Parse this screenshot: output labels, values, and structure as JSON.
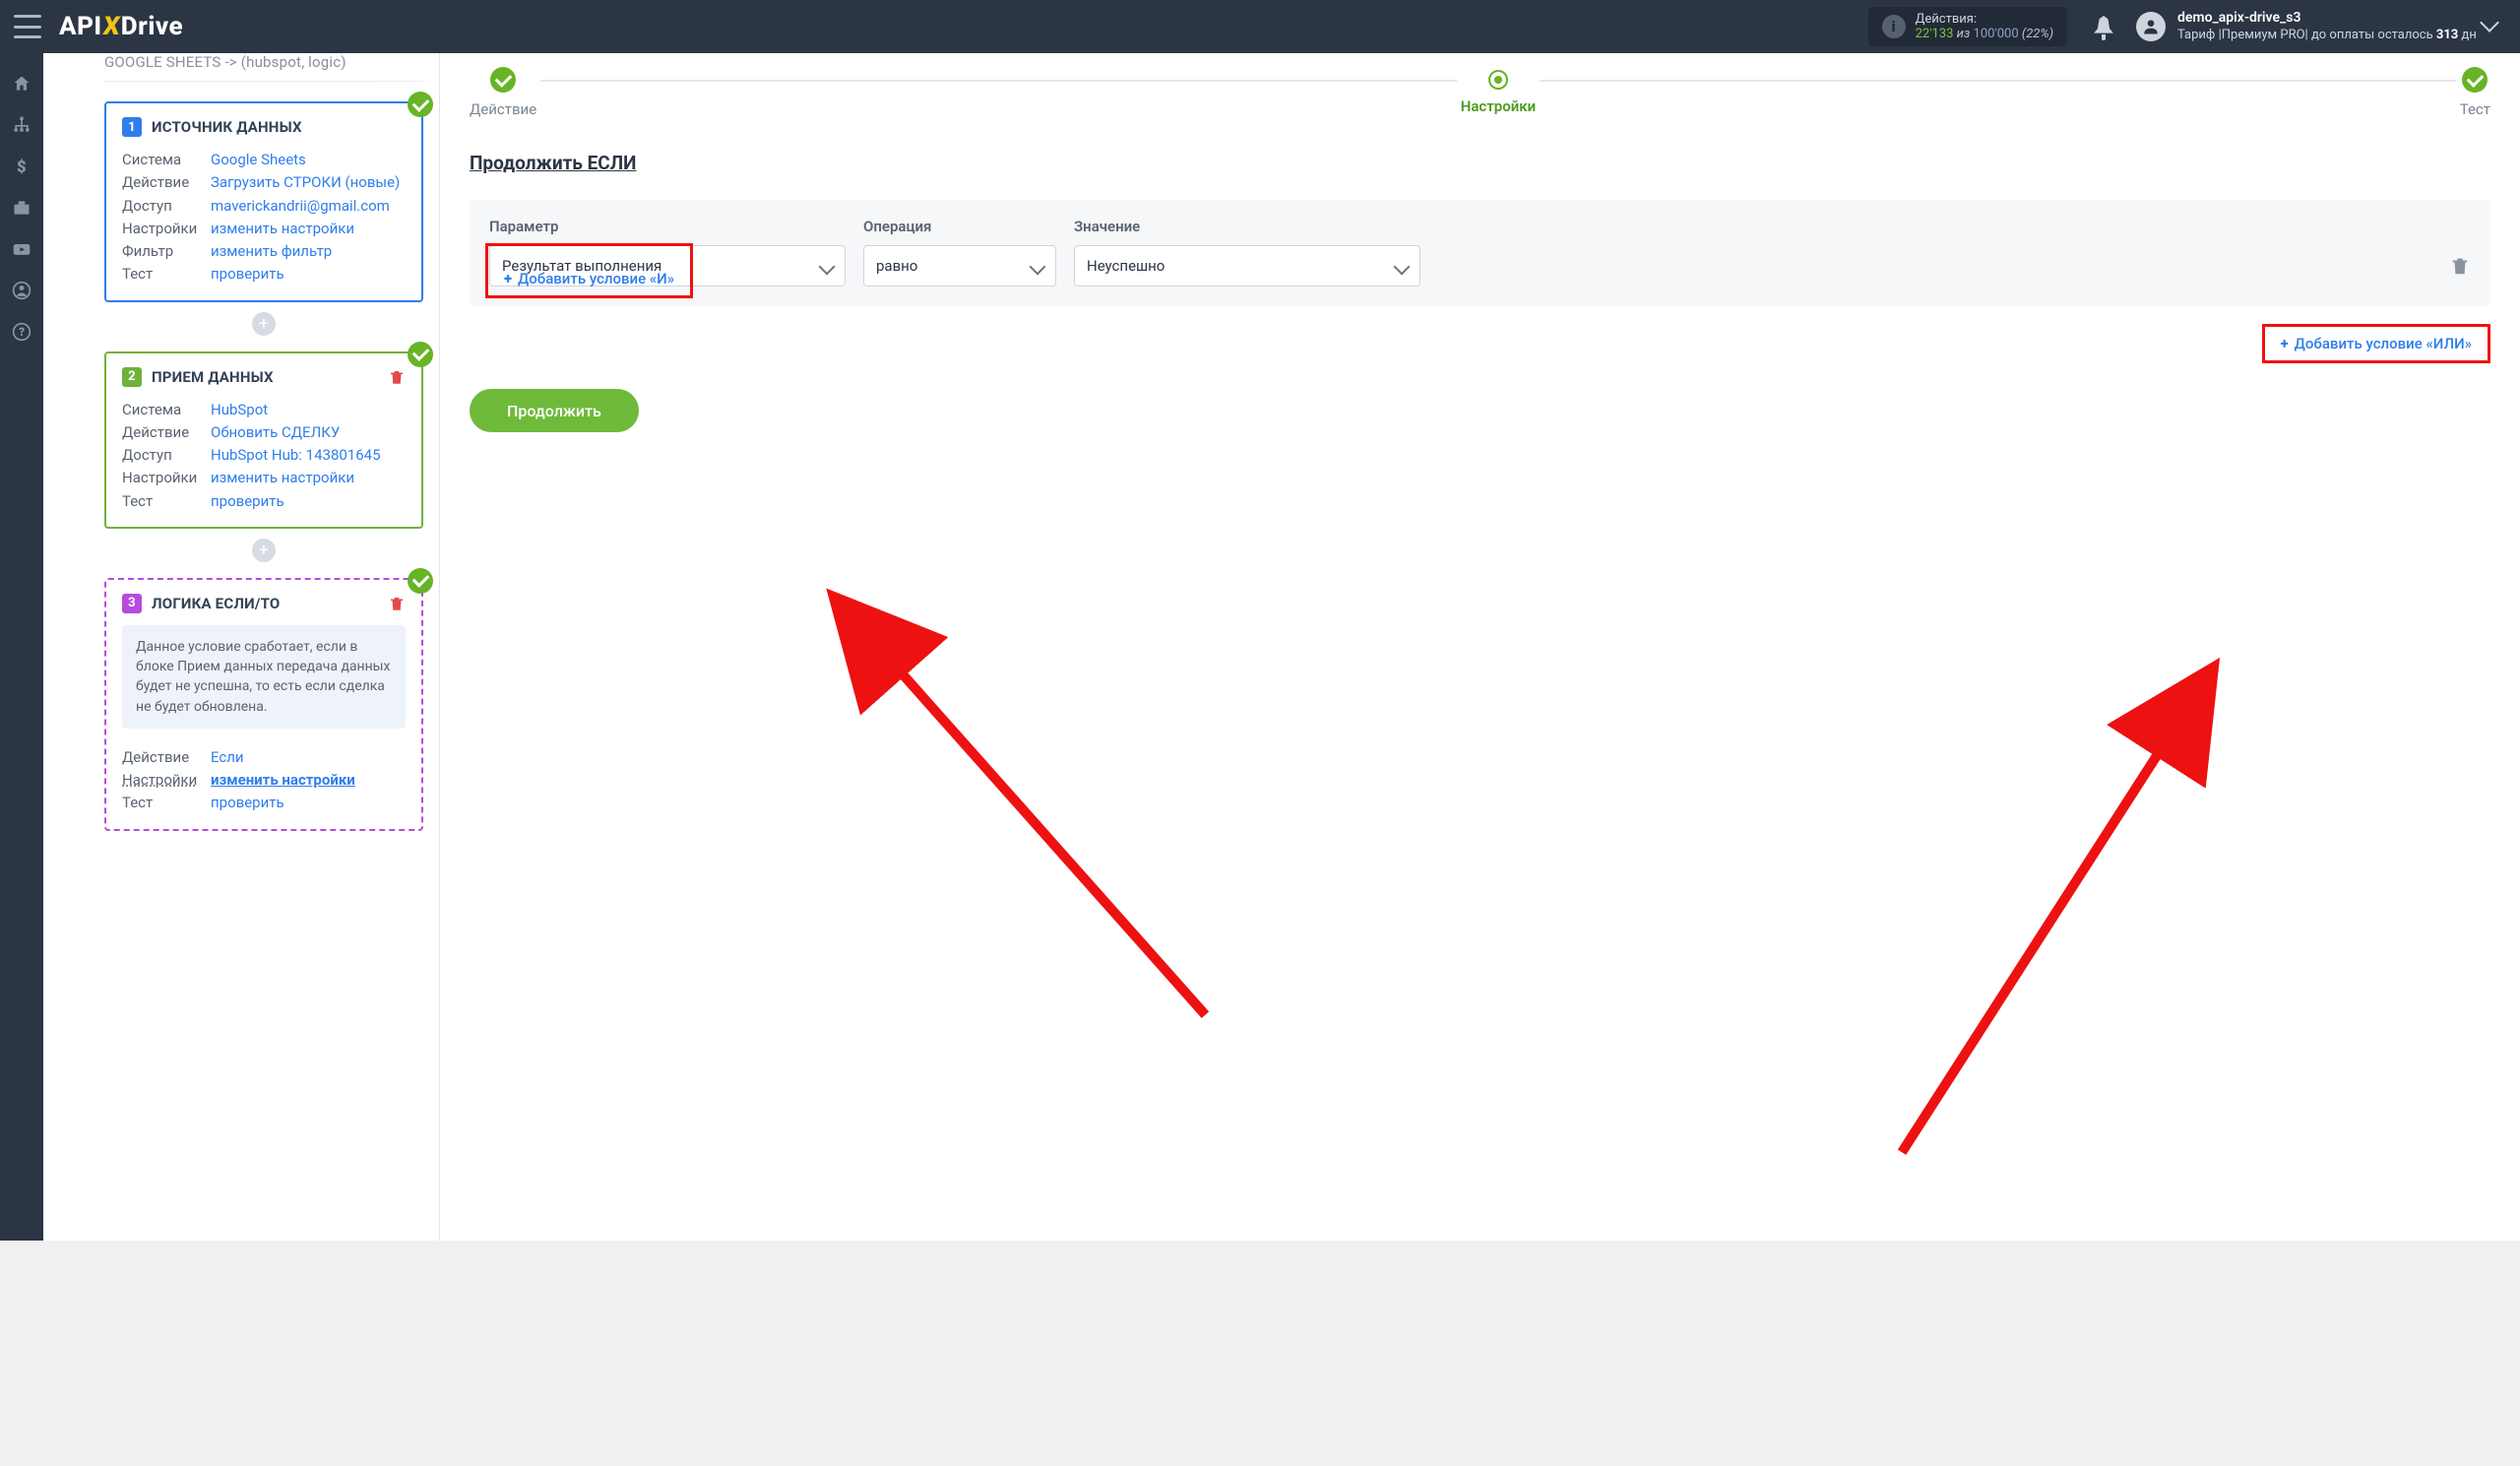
{
  "topbar": {
    "actions_label": "Действия:",
    "actions_used": "22'133",
    "actions_of": "из",
    "actions_total": "100'000",
    "actions_pct": "(22%)",
    "username": "demo_apix-drive_s3",
    "tariff_prefix": "Тариф |",
    "tariff_name": "Премиум PRO",
    "tariff_mid": "| до оплаты осталось ",
    "tariff_days": "313",
    "tariff_suffix": " дн"
  },
  "breadcrumb": "GOOGLE SHEETS -> (hubspot, logic)",
  "card1": {
    "title": "ИСТОЧНИК ДАННЫХ",
    "rows": {
      "sys_k": "Система",
      "sys_v": "Google Sheets",
      "act_k": "Действие",
      "act_v": "Загрузить СТРОКИ (новые)",
      "acc_k": "Доступ",
      "acc_v": "maverickandrii@gmail.com",
      "set_k": "Настройки",
      "set_v": "изменить настройки",
      "fil_k": "Фильтр",
      "fil_v": "изменить фильтр",
      "tst_k": "Тест",
      "tst_v": "проверить"
    }
  },
  "card2": {
    "title": "ПРИЕМ ДАННЫХ",
    "rows": {
      "sys_k": "Система",
      "sys_v": "HubSpot",
      "act_k": "Действие",
      "act_v": "Обновить СДЕЛКУ",
      "acc_k": "Доступ",
      "acc_v": "HubSpot Hub: 143801645",
      "set_k": "Настройки",
      "set_v": "изменить настройки",
      "tst_k": "Тест",
      "tst_v": "проверить"
    }
  },
  "card3": {
    "title": "ЛОГИКА ЕСЛИ/ТО",
    "desc": "Данное условие сработает, если в блоке Прием данных передача данных будет не успешна, то есть если сделка не будет обновлена.",
    "rows": {
      "act_k": "Действие",
      "act_v": "Если",
      "set_k": "Настройки",
      "set_v": "изменить настройки",
      "tst_k": "Тест",
      "tst_v": "проверить"
    }
  },
  "steps": {
    "s1": "Действие",
    "s2": "Настройки",
    "s3": "Тест"
  },
  "section_heading": "Продолжить ЕСЛИ",
  "cond": {
    "param_label": "Параметр",
    "param_value": "Результат выполнения",
    "oper_label": "Операция",
    "oper_value": "равно",
    "val_label": "Значение",
    "val_value": "Неуспешно"
  },
  "buttons": {
    "add_and": "Добавить условие «И»",
    "add_or": "Добавить условие «ИЛИ»",
    "cont": "Продолжить"
  }
}
